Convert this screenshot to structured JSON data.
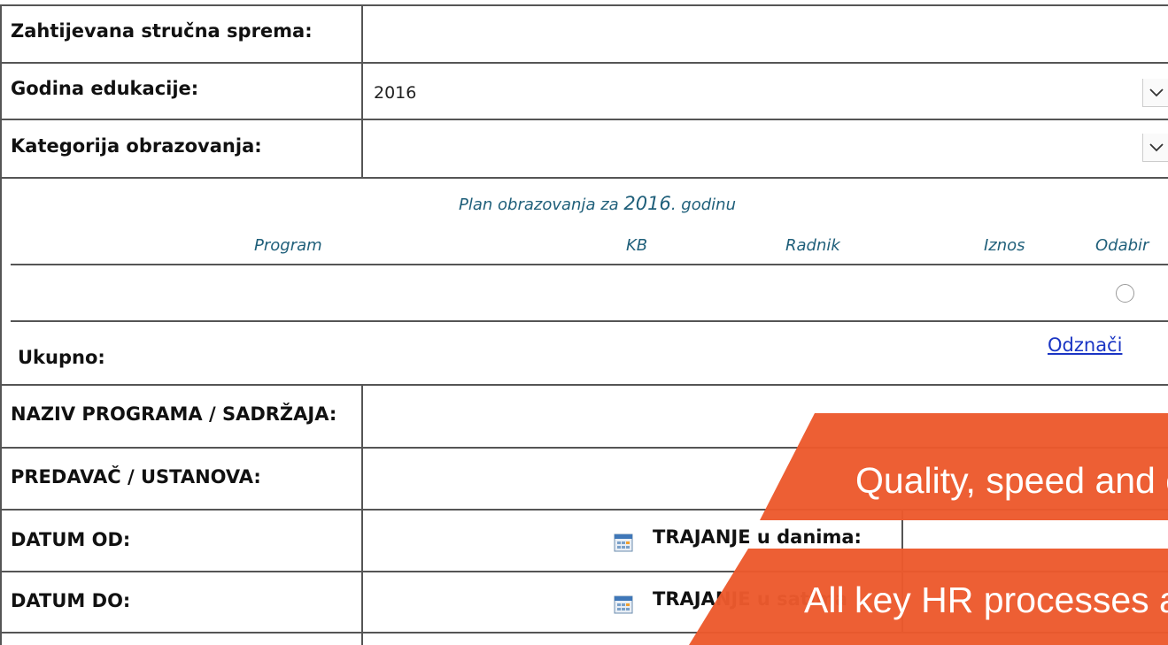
{
  "form": {
    "strucna_sprema_label": "Zahtijevana stručna sprema:",
    "godina_label": "Godina edukacije:",
    "godina_value": "2016",
    "kategorija_label": "Kategorija obrazovanja:",
    "kategorija_value": ""
  },
  "plan": {
    "title_prefix": "Plan obrazovanja za",
    "year": "2016",
    "title_suffix": ". godinu",
    "columns": [
      "Program",
      "KB",
      "Radnik",
      "Iznos",
      "Odabir"
    ],
    "total_label": "Ukupno:",
    "deselect_label": "Odznači"
  },
  "details": {
    "naziv_label": "NAZIV PROGRAMA / SADRŽAJA:",
    "predavac_label": "PREDAVAČ / USTANOVA:",
    "datum_od_label": "DATUM OD:",
    "datum_do_label": "DATUM DO:",
    "trajanje_dani_label": "TRAJANJE u danima:",
    "trajanje_sati_label": "TRAJANJE u satima"
  },
  "banner": {
    "line1": "Quality, speed and e",
    "line2": "All key HR processes a",
    "color": "#ec5a2d"
  },
  "colors": {
    "grid": "#555555",
    "header_italic": "#1f5f7a",
    "link": "#1a35c4"
  },
  "icons": {
    "dropdown": "chevron-down-icon",
    "calendar": "calendar-icon",
    "radio": "radio-button"
  }
}
